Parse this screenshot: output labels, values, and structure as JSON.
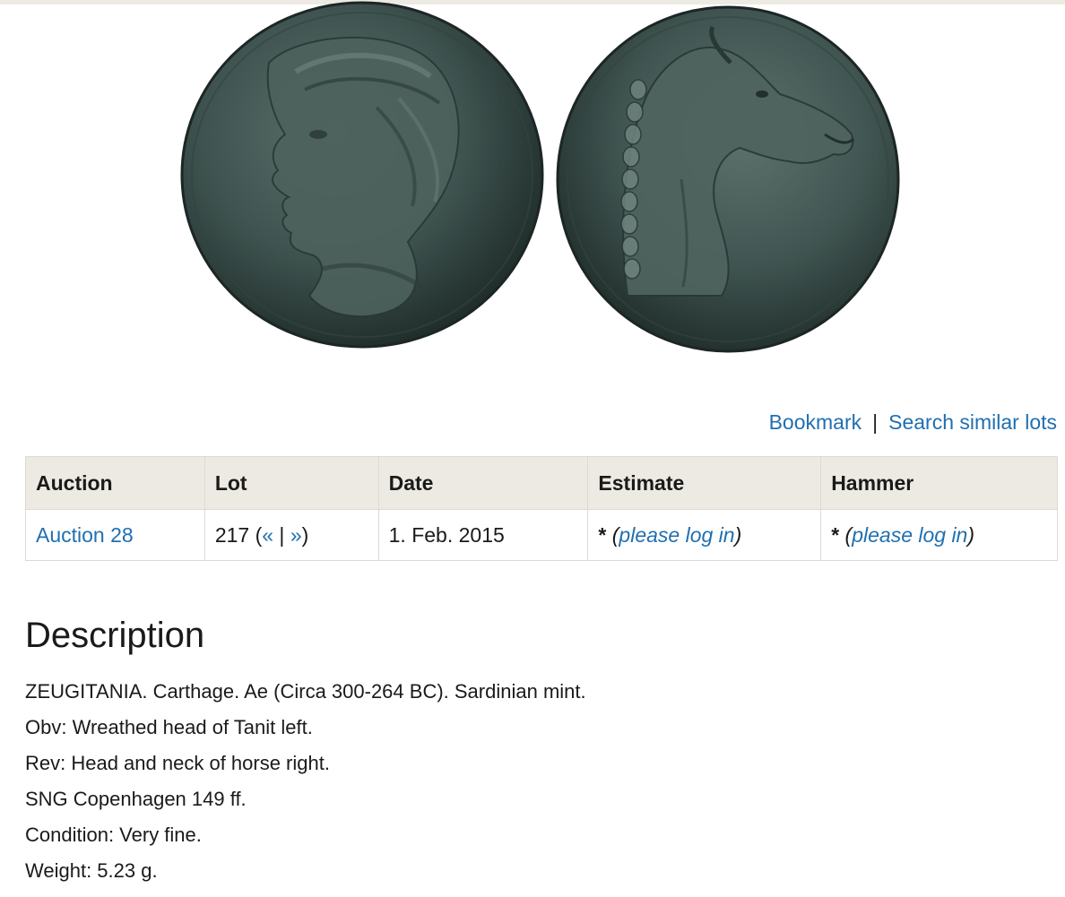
{
  "actions": {
    "bookmark": "Bookmark",
    "separator": "|",
    "search_similar": "Search similar lots"
  },
  "table": {
    "headers": {
      "auction": "Auction",
      "lot": "Lot",
      "date": "Date",
      "estimate": "Estimate",
      "hammer": "Hammer"
    },
    "row": {
      "auction": "Auction 28",
      "lot_number": "217",
      "lot_open": " (",
      "prev": "«",
      "lot_sep": " | ",
      "next": "»",
      "lot_close": ")",
      "date": "1. Feb. 2015",
      "estimate_star": "*",
      "estimate_login": "please log in",
      "hammer_star": "*",
      "hammer_login": "please log in"
    }
  },
  "description": {
    "title": "Description",
    "lines": [
      "ZEUGITANIA. Carthage. Ae (Circa 300-264 BC). Sardinian mint.",
      "Obv: Wreathed head of Tanit left.",
      "Rev: Head and neck of horse right.",
      "SNG Copenhagen 149 ff.",
      "Condition: Very fine.",
      "Weight: 5.23 g."
    ]
  },
  "colors": {
    "link": "#1f6fb0",
    "header_bg": "#eceae2",
    "border": "#dcdad2",
    "coin_patina": "#3f5450"
  }
}
